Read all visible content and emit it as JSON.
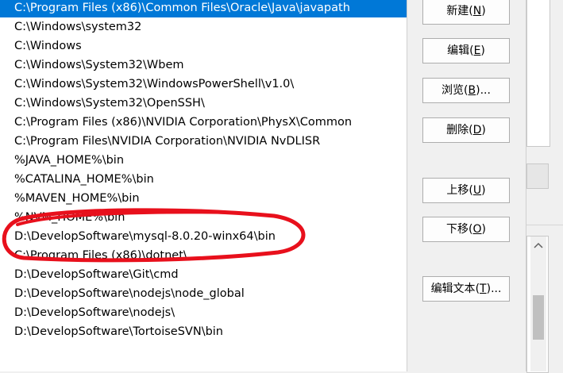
{
  "path_list": {
    "items": [
      "C:\\Program Files (x86)\\Common Files\\Oracle\\Java\\javapath",
      "C:\\Windows\\system32",
      "C:\\Windows",
      "C:\\Windows\\System32\\Wbem",
      "C:\\Windows\\System32\\WindowsPowerShell\\v1.0\\",
      "C:\\Windows\\System32\\OpenSSH\\",
      "C:\\Program Files (x86)\\NVIDIA Corporation\\PhysX\\Common",
      "C:\\Program Files\\NVIDIA Corporation\\NVIDIA NvDLISR",
      "%JAVA_HOME%\\bin",
      "%CATALINA_HOME%\\bin",
      "%MAVEN_HOME%\\bin",
      "%NVM_HOME%\\bin",
      "D:\\DevelopSoftware\\mysql-8.0.20-winx64\\bin",
      "C:\\Program Files (x86)\\dotnet\\",
      "D:\\DevelopSoftware\\Git\\cmd",
      "D:\\DevelopSoftware\\nodejs\\node_global",
      "D:\\DevelopSoftware\\nodejs\\",
      "D:\\DevelopSoftware\\TortoiseSVN\\bin"
    ],
    "selected_index": 0
  },
  "buttons": {
    "new": {
      "label": "新建",
      "key": "N"
    },
    "edit": {
      "label": "编辑",
      "key": "E"
    },
    "browse": {
      "label": "浏览",
      "key": "B",
      "suffix": "..."
    },
    "delete": {
      "label": "删除",
      "key": "D"
    },
    "move_up": {
      "label": "上移",
      "key": "U"
    },
    "move_down": {
      "label": "下移",
      "key": "O"
    },
    "edit_text": {
      "label": "编辑文本",
      "key": "T",
      "suffix": "..."
    }
  },
  "colors": {
    "selection": "#0078d7",
    "annotation": "#e8101c"
  }
}
